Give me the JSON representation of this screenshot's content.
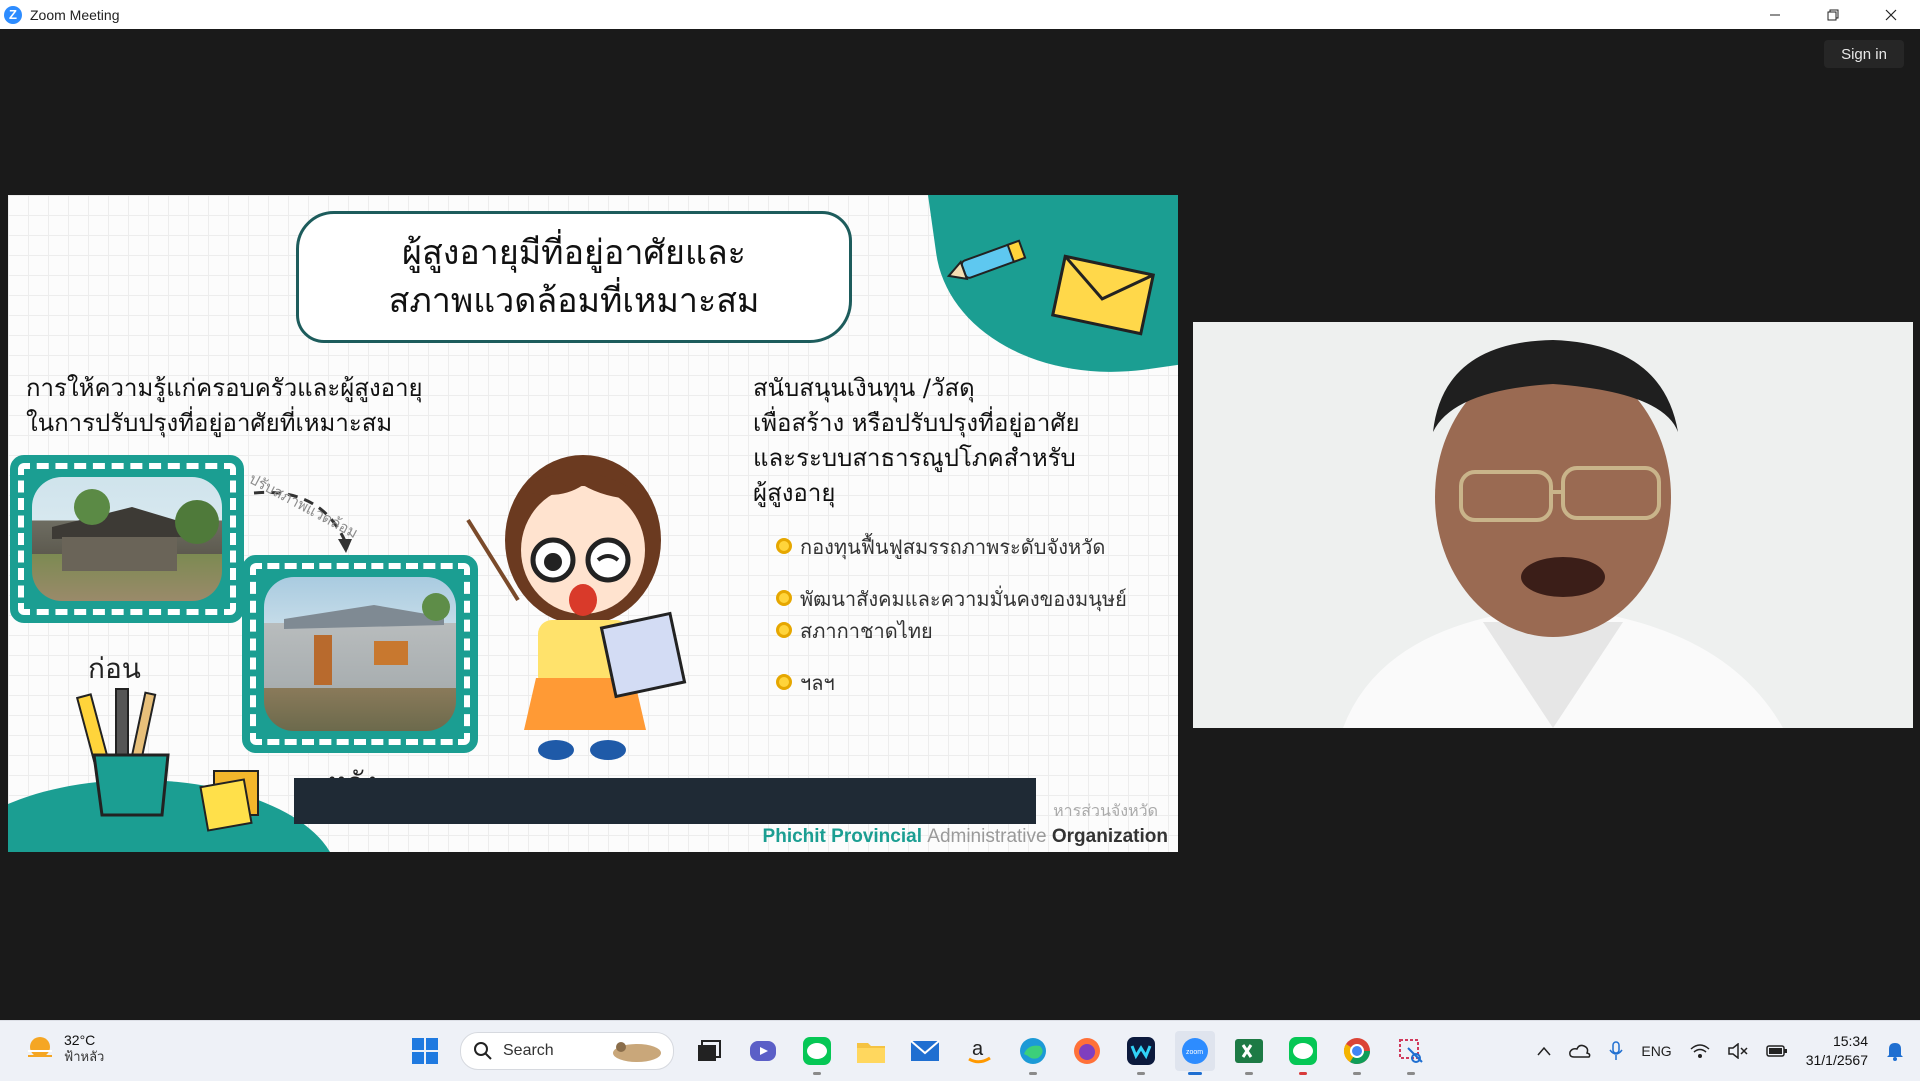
{
  "window": {
    "title": "Zoom Meeting",
    "sign_in_label": "Sign in",
    "app_icon_letter": "Z"
  },
  "slide": {
    "title_line1": "ผู้สูงอายุมีที่อยู่อาศัยและ",
    "title_line2": "สภาพแวดล้อมที่เหมาะสม",
    "left_heading_line1": "การให้ความรู้แก่ครอบครัวและผู้สูงอายุ",
    "left_heading_line2": "ในการปรับปรุงที่อยู่อาศัยที่เหมาะสม",
    "arrow_caption": "ปรับสภาพแวดล้อม",
    "before_caption": "ก่อน",
    "after_caption": "หลัง",
    "right_heading_line1": "สนับสนุนเงินทุน  /วัสดุ",
    "right_heading_line2": "เพื่อสร้าง  หรือปรับปรุงที่อยู่อาศัย",
    "right_heading_line3": "และระบบสาธารณูปโภคสำหรับ",
    "right_heading_line4": "ผู้สูงอายุ",
    "bullets": [
      "กองทุนฟื้นฟูสมรรถภาพระดับจังหวัด",
      "พัฒนาสังคมและความมั่นคงของมนุษย์",
      "สภากาชาดไทย",
      "ฯลฯ"
    ],
    "footer_thai": "หารส่วนจังหวัด",
    "footer_word1": "Phichit Provincial",
    "footer_word2": "Administrative",
    "footer_word3": "Organization"
  },
  "taskbar": {
    "weather_temp": "32°C",
    "weather_condition": "ฟ้าหลัว",
    "search_label": "Search",
    "language": "ENG",
    "time": "15:34",
    "date": "31/1/2567",
    "apps": [
      "start-icon",
      "search",
      "task-view-icon",
      "teams-icon",
      "line-icon",
      "file-explorer-icon",
      "mail-icon",
      "amazon-icon",
      "edge-icon",
      "firefox-icon",
      "webex-icon",
      "zoom-icon",
      "excel-icon",
      "line-icon",
      "chrome-icon",
      "snipping-tool-icon"
    ]
  },
  "colors": {
    "slide_teal": "#1b9e92",
    "zoom_blue": "#2d8cff",
    "bullet_yellow": "#ffd43b"
  }
}
